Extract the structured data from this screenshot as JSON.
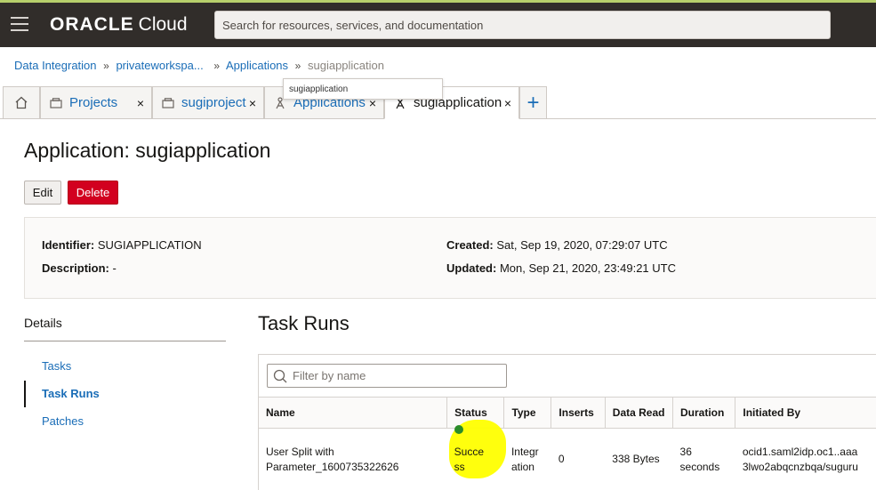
{
  "header": {
    "brand_main": "ORACLE",
    "brand_sub": "Cloud",
    "search_placeholder": "Search for resources, services, and documentation"
  },
  "breadcrumb": {
    "items": [
      "Data Integration",
      "privateworkspa...",
      "Applications"
    ],
    "current": "sugiapplication",
    "separator": "»"
  },
  "tooltip": "sugiapplication",
  "tabs": [
    {
      "label": "Projects",
      "icon": "project-icon"
    },
    {
      "label": "sugiproject",
      "icon": "project-icon"
    },
    {
      "label": "Applications",
      "icon": "application-icon"
    },
    {
      "label": "sugiapplication",
      "icon": "application-icon"
    }
  ],
  "close_glyph": "×",
  "plus_glyph": "+",
  "page": {
    "title": "Application: sugiapplication",
    "edit_label": "Edit",
    "delete_label": "Delete"
  },
  "info": {
    "identifier_label": "Identifier:",
    "identifier_value": "SUGIAPPLICATION",
    "description_label": "Description:",
    "description_value": "-",
    "created_label": "Created:",
    "created_value": "Sat, Sep 19, 2020, 07:29:07 UTC",
    "updated_label": "Updated:",
    "updated_value": "Mon, Sep 21, 2020, 23:49:21 UTC"
  },
  "sidebar": {
    "heading": "Details",
    "items": [
      "Tasks",
      "Task Runs",
      "Patches"
    ],
    "active": "Task Runs"
  },
  "task_runs": {
    "title": "Task Runs",
    "filter_placeholder": "Filter by name",
    "columns": [
      "Name",
      "Status",
      "Type",
      "Inserts",
      "Data Read",
      "Duration",
      "Initiated By"
    ],
    "rows": [
      {
        "name_line1": "User Split with",
        "name_line2": "Parameter_1600735322626",
        "status_line1": "Succe",
        "status_line2": "ss",
        "type_line1": "Integr",
        "type_line2": "ation",
        "inserts": "0",
        "data_read": "338 Bytes",
        "duration_line1": "36",
        "duration_line2": "seconds",
        "initiated_line1": "ocid1.saml2idp.oc1..aaa",
        "initiated_line2": "3lwo2abqcnzbqa/suguru"
      }
    ]
  },
  "colors": {
    "topbar": "#312d2a",
    "link": "#1a6db7",
    "delete": "#d2001f",
    "success": "#2a8c2a",
    "highlight": "#ffff00"
  }
}
